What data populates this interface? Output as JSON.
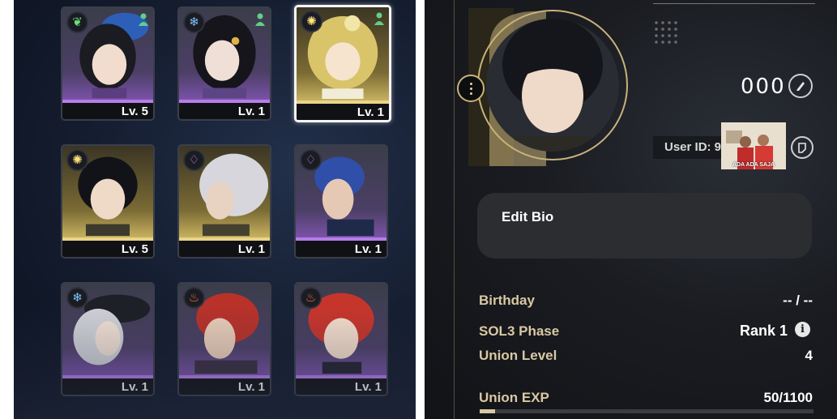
{
  "roster": {
    "cards": [
      {
        "level": "Lv. 5",
        "element": "nature-icon",
        "rarity": "purple",
        "badge": true
      },
      {
        "level": "Lv. 1",
        "element": "frost-icon",
        "rarity": "purple",
        "badge": true
      },
      {
        "level": "Lv. 1",
        "element": "light-icon",
        "rarity": "gold",
        "badge": true,
        "selected": true
      },
      {
        "level": "Lv. 5",
        "element": "light-icon",
        "rarity": "gold"
      },
      {
        "level": "Lv. 1",
        "element": "void-icon",
        "rarity": "gold"
      },
      {
        "level": "Lv. 1",
        "element": "void-icon",
        "rarity": "purple"
      },
      {
        "level": "Lv. 1",
        "element": "frost-icon",
        "rarity": "purple"
      },
      {
        "level": "Lv. 1",
        "element": "fire-icon",
        "rarity": "purple"
      },
      {
        "level": "Lv. 1",
        "element": "fire-icon",
        "rarity": "purple"
      }
    ]
  },
  "profile": {
    "name_value": "000",
    "user_id_label": "User ID: 9",
    "video_caption": "ADA ADA SAJA",
    "bio_label": "Edit Bio",
    "birthday_label": "Birthday",
    "birthday_value": "-- / --",
    "phase_label": "SOL3 Phase",
    "phase_value": "Rank 1",
    "info_glyph": "i",
    "union_level_label": "Union Level",
    "union_level_value": "4",
    "union_exp_label": "Union EXP",
    "union_exp_value": "50/1100",
    "union_exp_fraction": 0.045
  },
  "colors": {
    "purple_rarity": "#b67de8",
    "gold_rarity": "#e9d48a",
    "label_gold": "#d9c8a3"
  }
}
